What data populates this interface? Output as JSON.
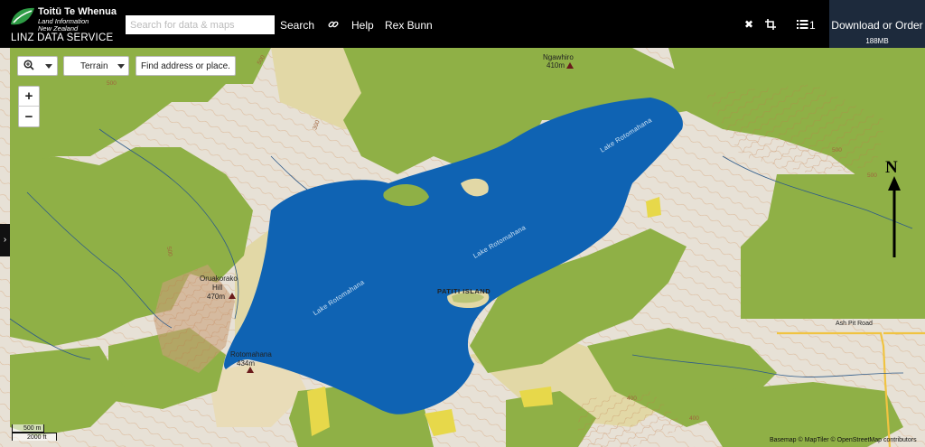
{
  "header": {
    "logo_line1": "Toitū Te Whenua",
    "logo_line2": "Land Information",
    "logo_line3": "New Zealand",
    "service_name": "LINZ DATA SERVICE",
    "search_placeholder": "Search for data & maps",
    "search_button": "Search",
    "help_label": "Help",
    "user_name": "Rex Bunn",
    "cart_count": "1",
    "download_label": "Download or Order",
    "download_size": "188MB",
    "icons": [
      "link-icon",
      "close-icon",
      "crop-icon",
      "list-icon"
    ]
  },
  "map_controls": {
    "basemap_selected": "Terrain",
    "address_placeholder": "Find address or place.",
    "zoom_in": "+",
    "zoom_out": "−",
    "icons": [
      "zoom-search-icon",
      "chevron-right-icon"
    ]
  },
  "map_labels": {
    "ngawhiro_name": "Ngawhiro",
    "ngawhiro_height": "410m",
    "oruakorako_name1": "Oruakorako",
    "oruakorako_name2": "Hill",
    "oruakorako_height": "470m",
    "rotomahana_name": "Rotomahana",
    "rotomahana_height": "434m",
    "lake_label_1": "Lake Rotomahana",
    "lake_label_2": "Lake Rotomahana",
    "lake_label_3": "Lake Rotomahana",
    "island": "PATITI ISLAND",
    "road": "Ash Pit Road",
    "contour_labels": [
      "500",
      "500",
      "500",
      "500",
      "400",
      "400",
      "300",
      "500"
    ]
  },
  "scale": {
    "metric": "500 m",
    "imperial": "2000 ft"
  },
  "attribution": "Basemap © MapTiler © OpenStreetMap contributors",
  "north_label": "N",
  "colors": {
    "header_bg": "#000000",
    "download_bg": "#1d2a3c",
    "lake": "#0f63b3",
    "forest": "#8fb046",
    "terrain_light": "#e7e1d6",
    "sand": "#e2d8a6",
    "yellow": "#e7d84a",
    "peak": "#6a1b1b"
  }
}
